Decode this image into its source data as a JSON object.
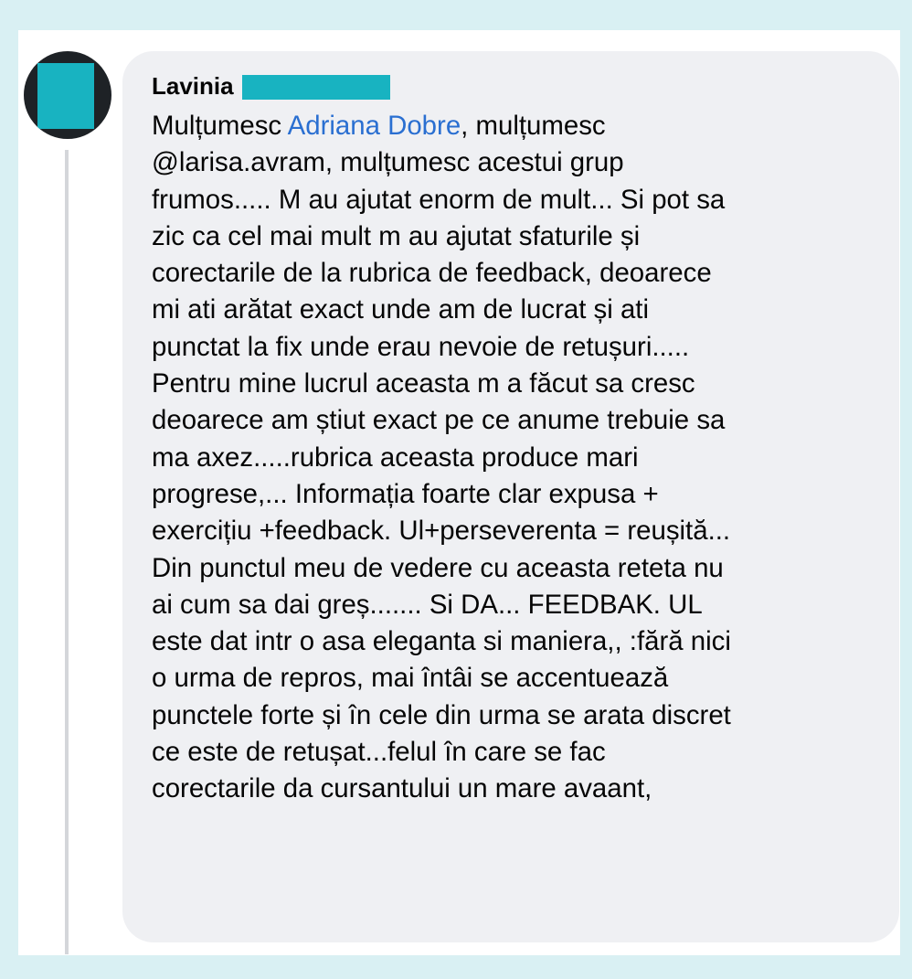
{
  "comment": {
    "author": "Lavinia",
    "mention_name": "Adriana Dobre",
    "line_1_before": "Mulțumesc ",
    "line_1_after": ", mulțumesc",
    "lines": [
      "@larisa.avram, mulțumesc acestui grup",
      "frumos..... M au ajutat enorm de mult... Si pot sa",
      "zic ca cel mai mult m au ajutat sfaturile și",
      "corectarile de la rubrica de feedback, deoarece",
      "mi ati arătat exact unde am de lucrat și ati",
      "punctat la fix unde erau nevoie de retușuri.....",
      "Pentru mine lucrul aceasta m a făcut sa cresc",
      "deoarece am știut exact pe ce anume trebuie sa",
      "ma axez.....rubrica aceasta produce mari",
      "progrese,... Informația foarte clar expusa +",
      "exercițiu +feedback. Ul+perseverenta = reușită...",
      "Din punctul meu de vedere cu aceasta reteta nu",
      "ai cum sa dai greș....... Si DA... FEEDBAK. UL",
      "este dat intr o asa eleganta si  maniera,, :fără nici",
      "o urma de repros, mai întâi se accentuează",
      "punctele forte și în cele din urma se arata discret",
      "ce este de retușat...felul în care se fac",
      "corectarile  da cursantului un mare avaant,"
    ]
  },
  "colors": {
    "background": "#d9f0f3",
    "bubble": "#eff0f3",
    "mention_link": "#2a6fd1",
    "redaction": "#18b3c1"
  }
}
